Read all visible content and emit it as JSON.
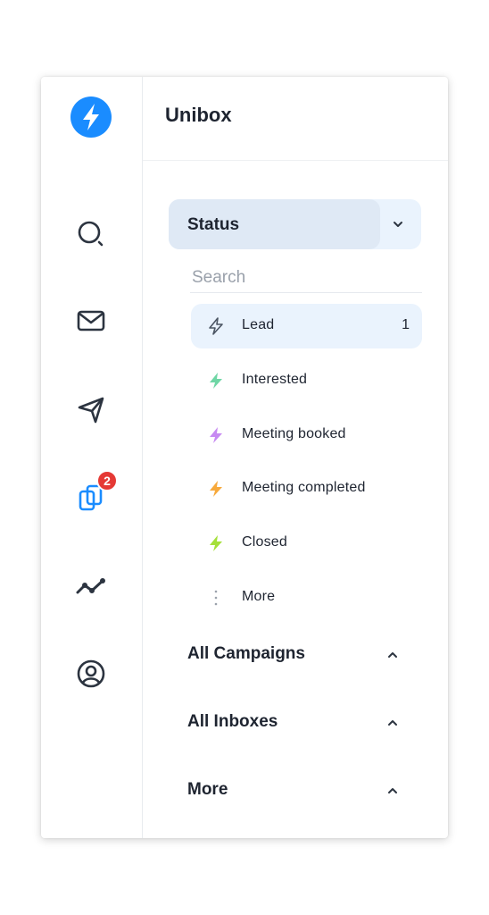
{
  "app": {
    "title": "Unibox"
  },
  "colors": {
    "brand": "#1a8cff",
    "active_bg": "#eaf3fd",
    "badge": "#e53935"
  },
  "rail": {
    "items": [
      {
        "name": "search-icon"
      },
      {
        "name": "mail-icon"
      },
      {
        "name": "send-icon"
      },
      {
        "name": "unibox-icon",
        "badge": "2"
      },
      {
        "name": "analytics-icon"
      },
      {
        "name": "account-icon"
      }
    ]
  },
  "status": {
    "label": "Status",
    "search_placeholder": "Search",
    "items": [
      {
        "label": "Lead",
        "count": "1",
        "icon": "bolt-outline-icon",
        "color": "#4b5563"
      },
      {
        "label": "Interested",
        "count": "",
        "icon": "bolt-icon",
        "color": "#6fd6a5"
      },
      {
        "label": "Meeting booked",
        "count": "",
        "icon": "bolt-icon",
        "color": "#c78af2"
      },
      {
        "label": "Meeting completed",
        "count": "",
        "icon": "bolt-icon",
        "color": "#f7a93b"
      },
      {
        "label": "Closed",
        "count": "",
        "icon": "bolt-icon",
        "color": "#a5e03a"
      },
      {
        "label": "More",
        "count": "",
        "icon": "vertical-dots-icon",
        "color": "#9aa1ab"
      }
    ]
  },
  "sections": [
    {
      "label": "All Campaigns"
    },
    {
      "label": "All Inboxes"
    },
    {
      "label": "More"
    }
  ]
}
